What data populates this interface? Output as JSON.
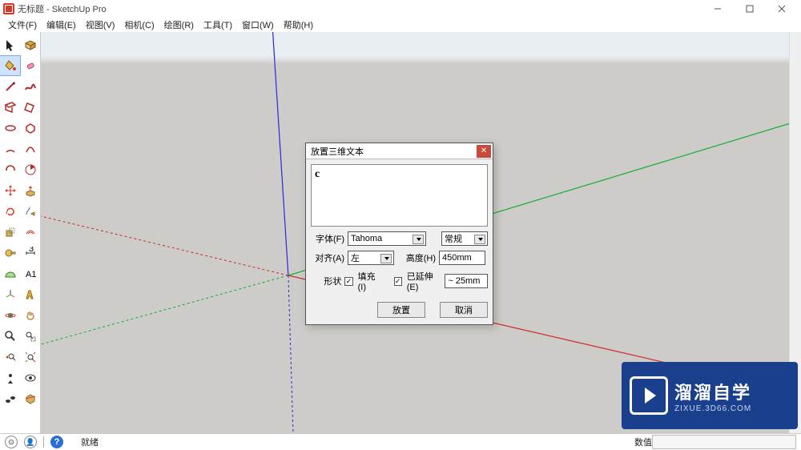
{
  "titlebar": {
    "title": "无标题 - SketchUp Pro"
  },
  "menu": {
    "file": "文件(F)",
    "edit": "编辑(E)",
    "view": "视图(V)",
    "camera": "相机(C)",
    "draw": "绘图(R)",
    "tools": "工具(T)",
    "window": "窗口(W)",
    "help": "帮助(H)"
  },
  "statusbar": {
    "ready": "就绪",
    "value_label": "数值"
  },
  "dialog": {
    "title": "放置三维文本",
    "text_value": "c",
    "font_label": "字体(F)",
    "font_value": "Tahoma",
    "weight_value": "常规",
    "align_label": "对齐(A)",
    "align_value": "左",
    "height_label": "高度(H)",
    "height_value": "450mm",
    "shape_label": "形状",
    "fill_label": "填充(I)",
    "ext_label": "已延伸(E)",
    "ext_value": "~ 25mm",
    "place_btn": "放置",
    "cancel_btn": "取消"
  },
  "watermark": {
    "main": "溜溜自学",
    "sub": "ZIXUE.3D66.COM"
  }
}
